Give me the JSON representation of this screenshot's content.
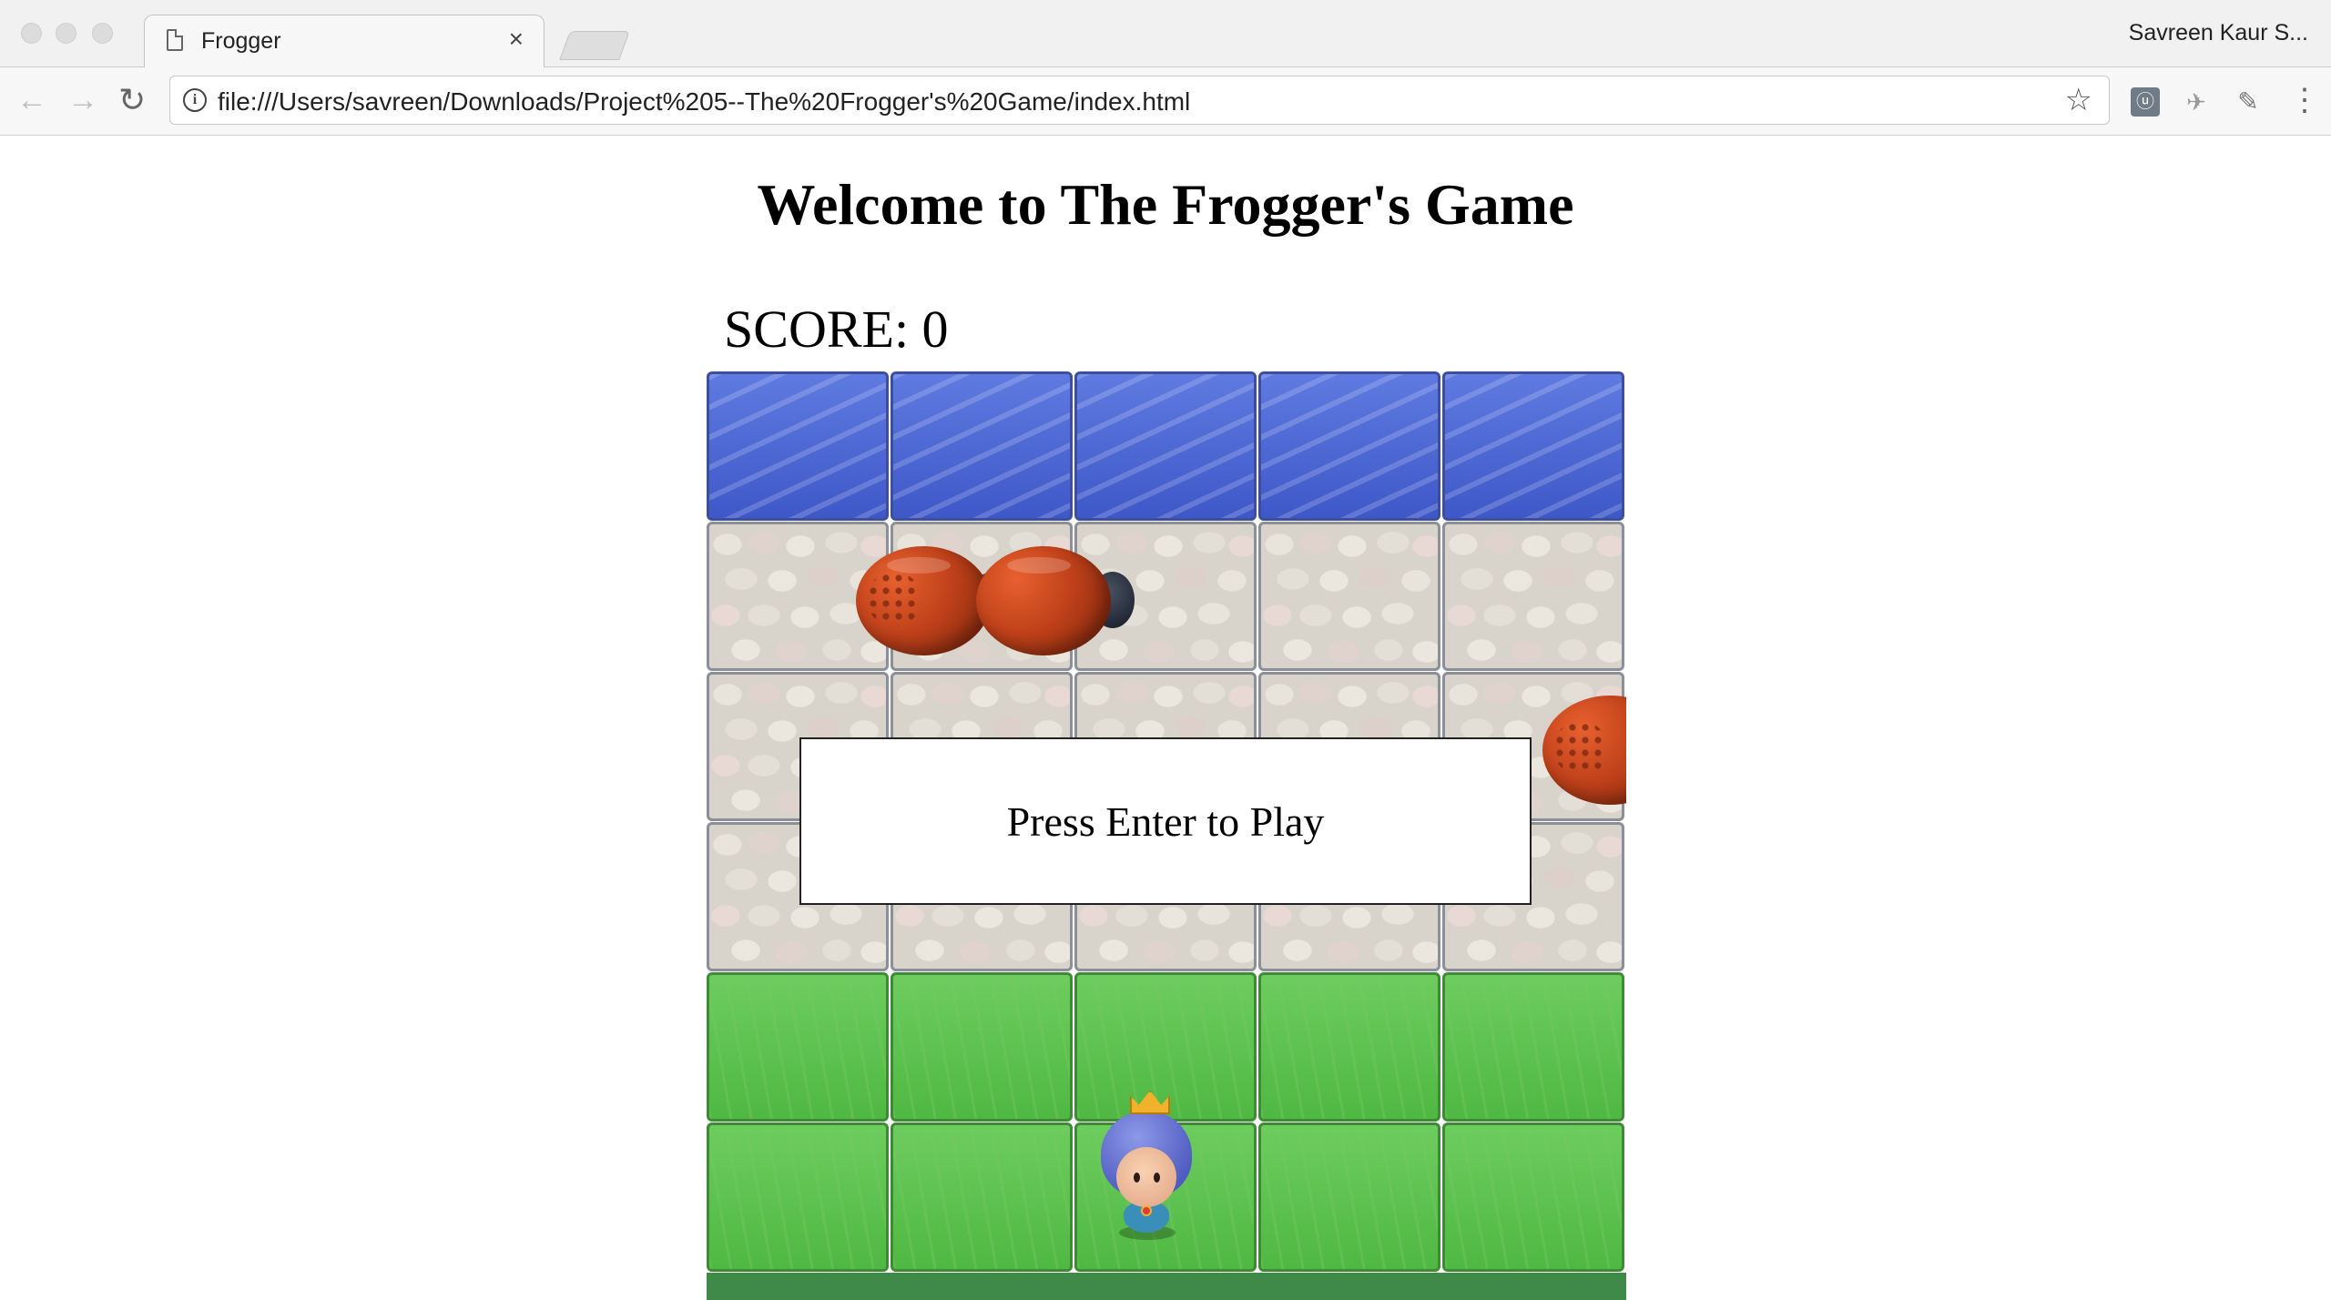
{
  "browser": {
    "tab_title": "Frogger",
    "tab_close": "×",
    "profile_name": "Savreen Kaur S...",
    "url": "file:///Users/savreen/Downloads/Project%205--The%20Frogger's%20Game/index.html",
    "icons": [
      "document-icon",
      "close-icon",
      "back-arrow-icon",
      "forward-arrow-icon",
      "reload-icon",
      "info-icon",
      "star-icon",
      "extension-icon",
      "extension-bird-icon",
      "eyedropper-icon",
      "menu-dots-icon"
    ]
  },
  "page": {
    "title": "Welcome to The Frogger's Game",
    "score_text": "SCORE: 0",
    "modal_text": "Press Enter to Play"
  },
  "colors": {
    "water": "#4f69d6",
    "grass": "#5cc24e",
    "stone": "#d9d4cb",
    "bug": "#c0411a"
  }
}
